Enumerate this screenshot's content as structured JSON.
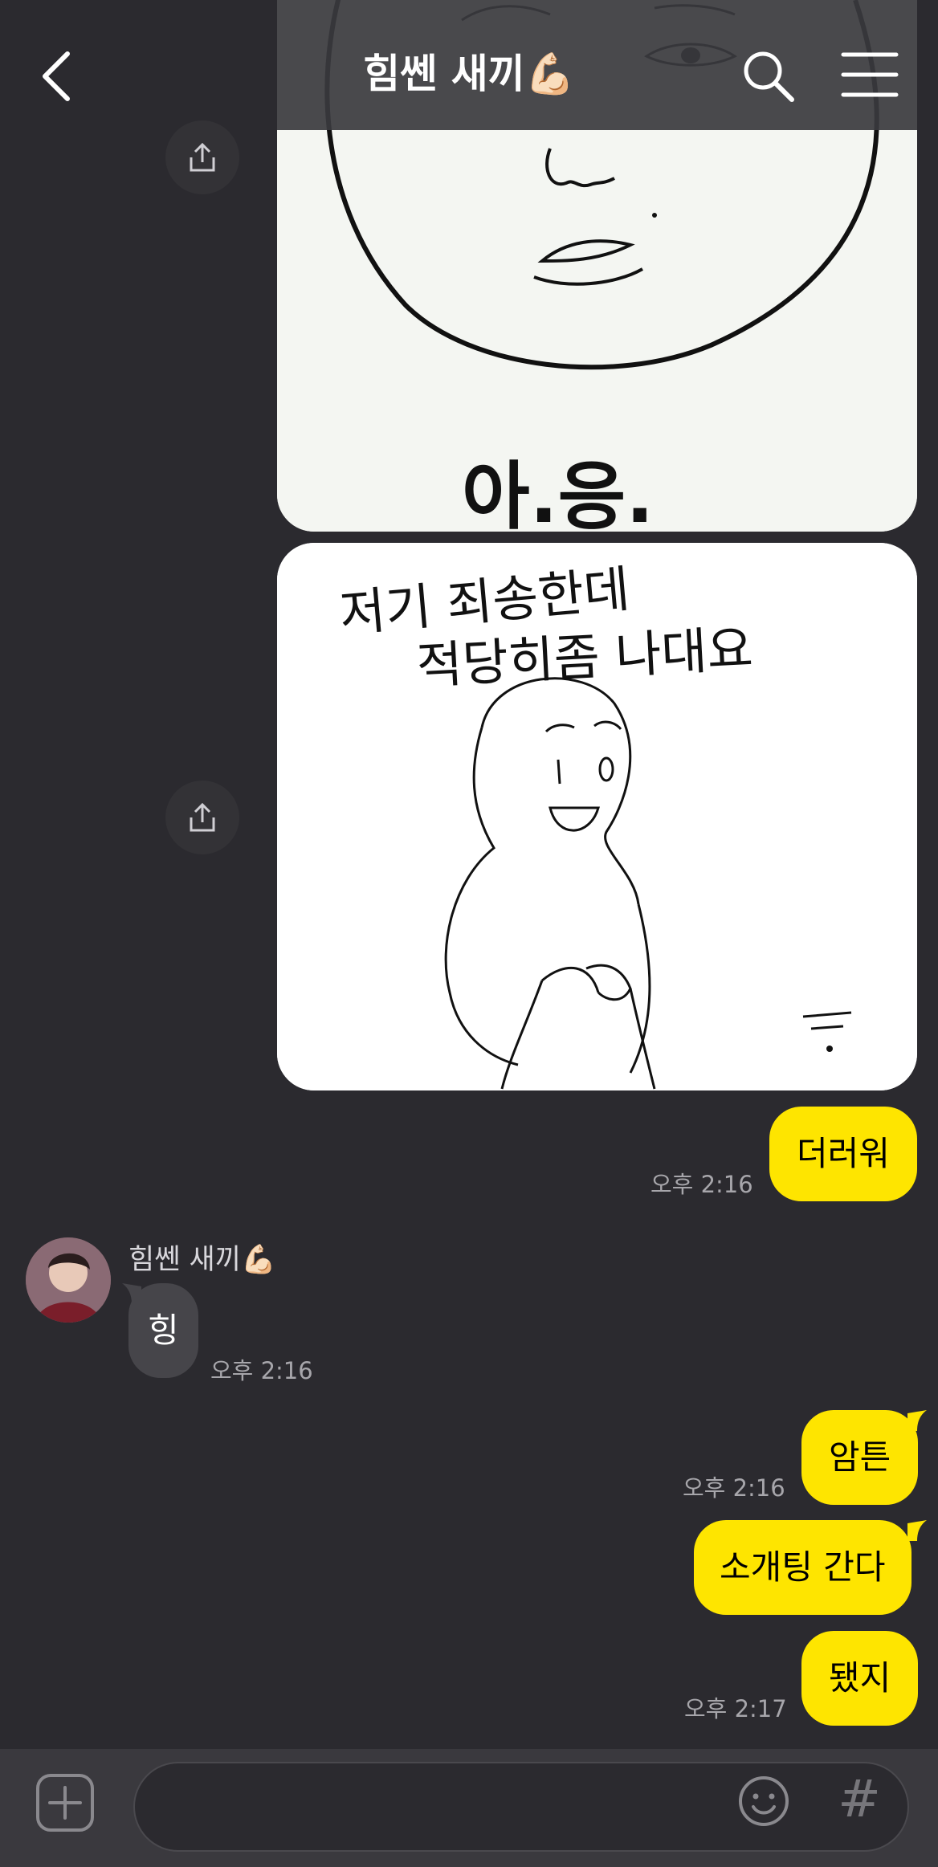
{
  "header": {
    "title": "힘쎈 새끼",
    "title_emoji": "💪🏻",
    "back_icon": "chevron-left-icon",
    "search_icon": "search-icon",
    "menu_icon": "hamburger-menu-icon"
  },
  "images": [
    {
      "caption": "아.응.",
      "share_icon": "share-icon"
    },
    {
      "caption_line1": "저기 죄송한데",
      "caption_line2": "적당히좀 나대요",
      "share_icon": "share-icon"
    }
  ],
  "messages": [
    {
      "sender": "me",
      "text": "더러워",
      "time": "오후 2:16"
    },
    {
      "sender": "them",
      "name": "힘쎈 새끼",
      "name_emoji": "💪🏻",
      "text": "힝",
      "time": "오후 2:16"
    },
    {
      "sender": "me",
      "text": "암튼",
      "time": "오후 2:16"
    },
    {
      "sender": "me",
      "text": "소개팅 간다",
      "time": ""
    },
    {
      "sender": "me",
      "text": "됐지",
      "time": "오후 2:17"
    }
  ],
  "input": {
    "placeholder": "",
    "plus_icon": "plus-icon",
    "emoji_icon": "emoji-icon",
    "hash_label": "#"
  },
  "colors": {
    "background": "#2b2a2f",
    "my_bubble": "#fee500",
    "their_bubble": "#46454a",
    "timestamp": "#a7a6ab"
  }
}
